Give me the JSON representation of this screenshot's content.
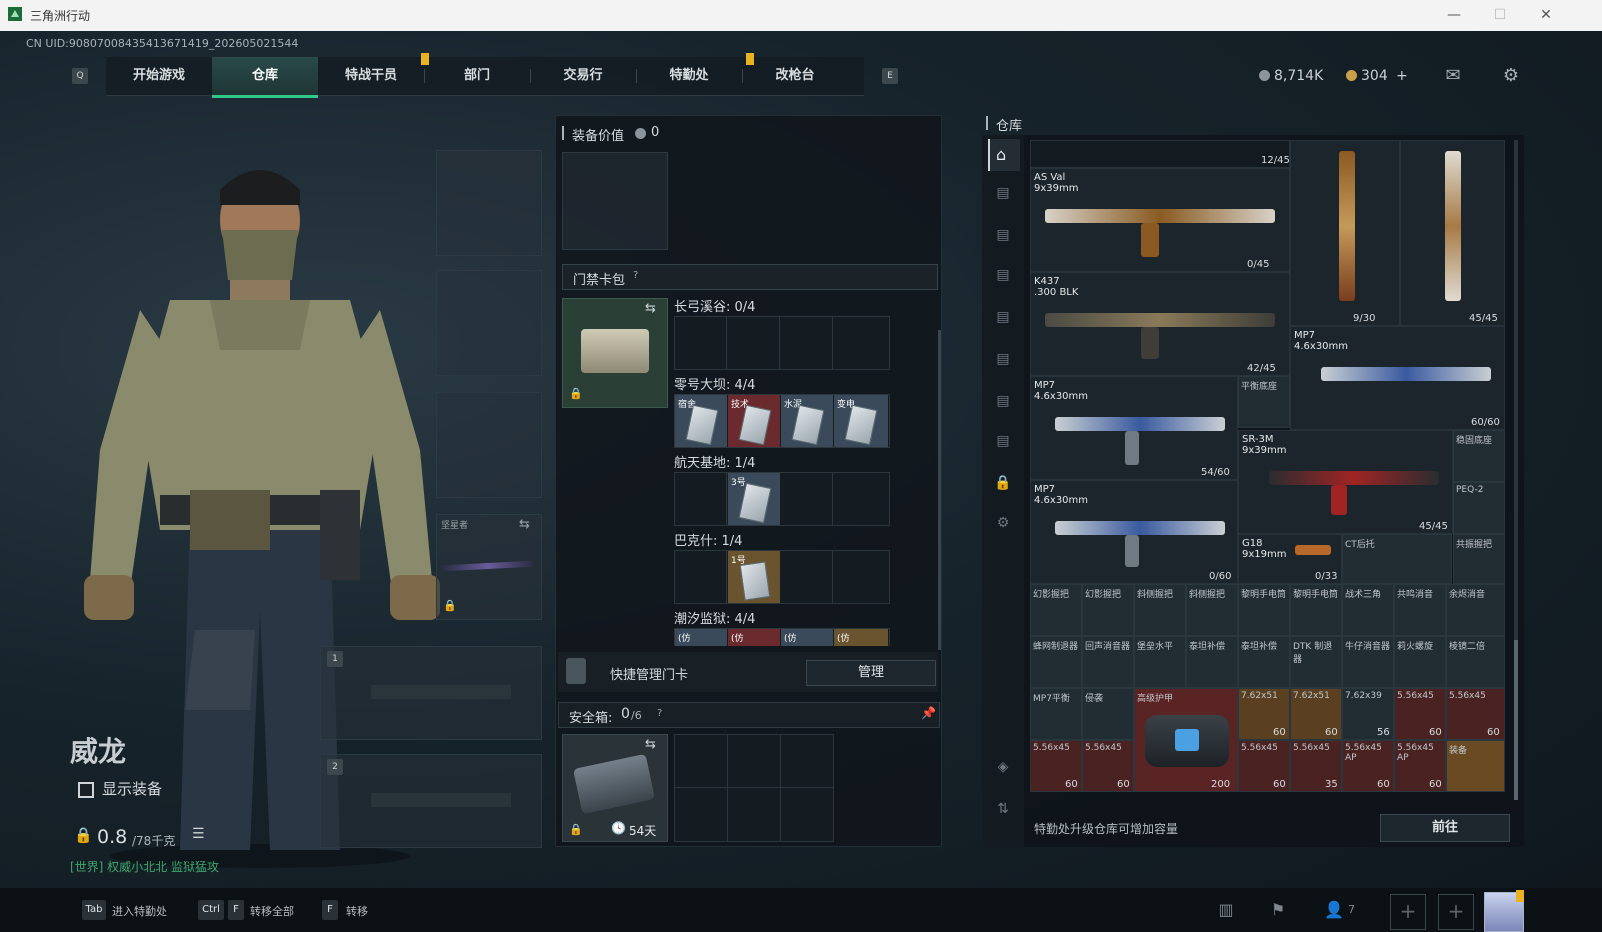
{
  "window": {
    "title": "三角洲行动"
  },
  "uid": "CN UID:9080700843541367141​9_202605021544",
  "nav": {
    "left_key": "Q",
    "right_key": "E",
    "tabs": [
      "开始游戏",
      "仓库",
      "特战干员",
      "部门",
      "交易行",
      "特勤处",
      "改枪台"
    ],
    "active": "仓库"
  },
  "currency": {
    "silver": "8,714K",
    "gold": "304",
    "plus": "+"
  },
  "character": {
    "name": "威龙",
    "show_gear_label": "显示装备",
    "weight": "0.8",
    "weight_unit": "/78千克",
    "chat_line": "[世界] 权威小北北  监狱猛攻"
  },
  "gear_slots": {
    "melee_label": "坚星者",
    "weapon1_index": "1",
    "weapon2_index": "2"
  },
  "equipment": {
    "value_label": "装备价值",
    "value": "0",
    "keycard_header": "门禁卡包",
    "help": "?",
    "groups": [
      {
        "name": "长弓溪谷: 0/4",
        "cards": []
      },
      {
        "name": "零号大坝: 4/4",
        "cards": [
          "宿舍",
          "技术",
          "水泥",
          "变电"
        ]
      },
      {
        "name": "航天基地: 1/4",
        "cards": [
          "3号"
        ]
      },
      {
        "name": "巴克什: 1/4",
        "cards": [
          "1号"
        ]
      },
      {
        "name": "潮汐监狱: 4/4",
        "cards": [
          "(仿",
          "(仿",
          "(仿",
          "(仿"
        ]
      }
    ],
    "quick_manage_label": "快捷管理门卡",
    "manage_button": "管理",
    "safebox_label": "安全箱:",
    "safebox_count": "0",
    "safebox_capacity": "/6",
    "safebox_days": "54天"
  },
  "stash": {
    "title": "仓库",
    "count_top": "12/45",
    "weapons": [
      {
        "name": "AS Val",
        "caliber": "9x39mm",
        "count": "0/45"
      },
      {
        "name": "",
        "caliber": "",
        "count": "9/30"
      },
      {
        "name": "",
        "caliber": "",
        "count": "45/45"
      },
      {
        "name": "K437",
        "caliber": ".300 BLK",
        "count": "42/45"
      },
      {
        "name": "MP7",
        "caliber": "4.6x30mm",
        "count": "60/60"
      },
      {
        "name": "MP7",
        "caliber": "4.6x30mm",
        "count": "54/60"
      },
      {
        "name": "SR-3M",
        "caliber": "9x39mm",
        "count": "45/45"
      },
      {
        "name": "MP7",
        "caliber": "4.6x30mm",
        "count": "0/60"
      },
      {
        "name": "G18",
        "caliber": "9x19mm",
        "count": "0/33"
      }
    ],
    "small_labels": [
      "平衡底座",
      "稳固底座",
      "PEQ-2",
      "CT后托",
      "共振握把"
    ],
    "row_a": [
      "幻影握把",
      "幻影握把",
      "斜侧握把",
      "斜侧握把",
      "黎明手电筒",
      "黎明手电筒",
      "战术三角",
      "共鸣消音",
      "余烬消音"
    ],
    "row_b": [
      "蜂网制退器",
      "回声消音器",
      "堡垒水平",
      "泰坦补偿",
      "泰坦补偿",
      "DTK 制退器",
      "牛仔消音器",
      "莉火螺旋",
      "棱镜二倍"
    ],
    "row_c": [
      {
        "label": "MP7平衡",
        "count": ""
      },
      {
        "label": "侵袭",
        "count": ""
      },
      {
        "label": "高级护甲",
        "count": "200"
      },
      {
        "label": "7.62x51",
        "count": "60"
      },
      {
        "label": "7.62x51",
        "count": "60"
      },
      {
        "label": "7.62x39",
        "count": "56"
      },
      {
        "label": "5.56x45",
        "count": "60"
      },
      {
        "label": "5.56x45",
        "count": "60"
      }
    ],
    "row_d": [
      {
        "label": "5.56x45",
        "count": "60"
      },
      {
        "label": "5.56x45",
        "count": "60"
      },
      {
        "label": "5.56x45",
        "count": "60"
      },
      {
        "label": "5.56x45",
        "count": "35"
      },
      {
        "label": "5.56x45 AP",
        "count": "60"
      },
      {
        "label": "5.56x45 AP",
        "count": "60"
      },
      {
        "label": "装备",
        "count": ""
      }
    ],
    "upgrade_hint": "特勤处升级仓库可增加容量",
    "goto_button": "前往"
  },
  "bottom": {
    "hints": [
      {
        "key": "Tab",
        "text": "进入特勤处"
      },
      {
        "key": "Ctrl",
        "key2": "F",
        "text": "转移全部"
      },
      {
        "key": "F",
        "text": "转移"
      }
    ],
    "friends_count": "7"
  },
  "colors": {
    "accent": "#2ec98b",
    "notif": "#e8b321",
    "rare_red": "#7a2424",
    "rare_gold": "#9a7a2a"
  }
}
